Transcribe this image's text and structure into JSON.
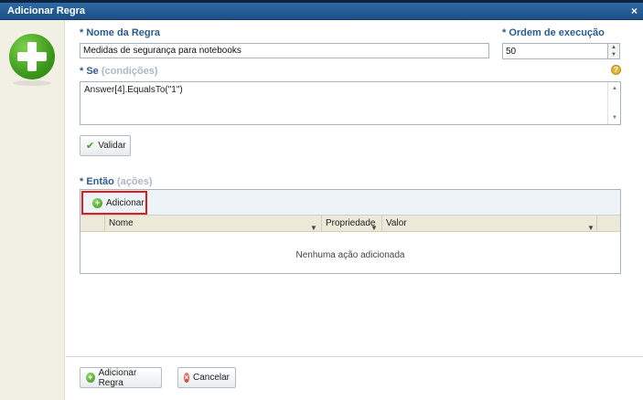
{
  "window": {
    "title": "Adicionar Regra",
    "close_glyph": "×"
  },
  "rule_name": {
    "label": "* Nome da Regra",
    "value": "Medidas de segurança para notebooks"
  },
  "order": {
    "label": "* Ordem de execução",
    "value": "50"
  },
  "conditions": {
    "label_prefix": "* Se",
    "label_suffix": "(condições)",
    "value": "Answer[4].EqualsTo(\"1\")"
  },
  "validate_button": {
    "label": "Validar",
    "icon": "checkmark-icon"
  },
  "actions": {
    "label_prefix": "* Então",
    "label_suffix": "(ações)",
    "add_button": {
      "label": "Adicionar",
      "icon": "add-circle-icon"
    },
    "columns": [
      "Nome",
      "Propriedade",
      "Valor"
    ],
    "empty_text": "Nenhuma ação adicionada"
  },
  "footer": {
    "add_rule_label": "Adicionar Regra",
    "cancel_label": "Cancelar"
  },
  "colors": {
    "titlebar": "#1c4f86",
    "label": "#2b5c8e",
    "highlight": "#e01b1b"
  }
}
